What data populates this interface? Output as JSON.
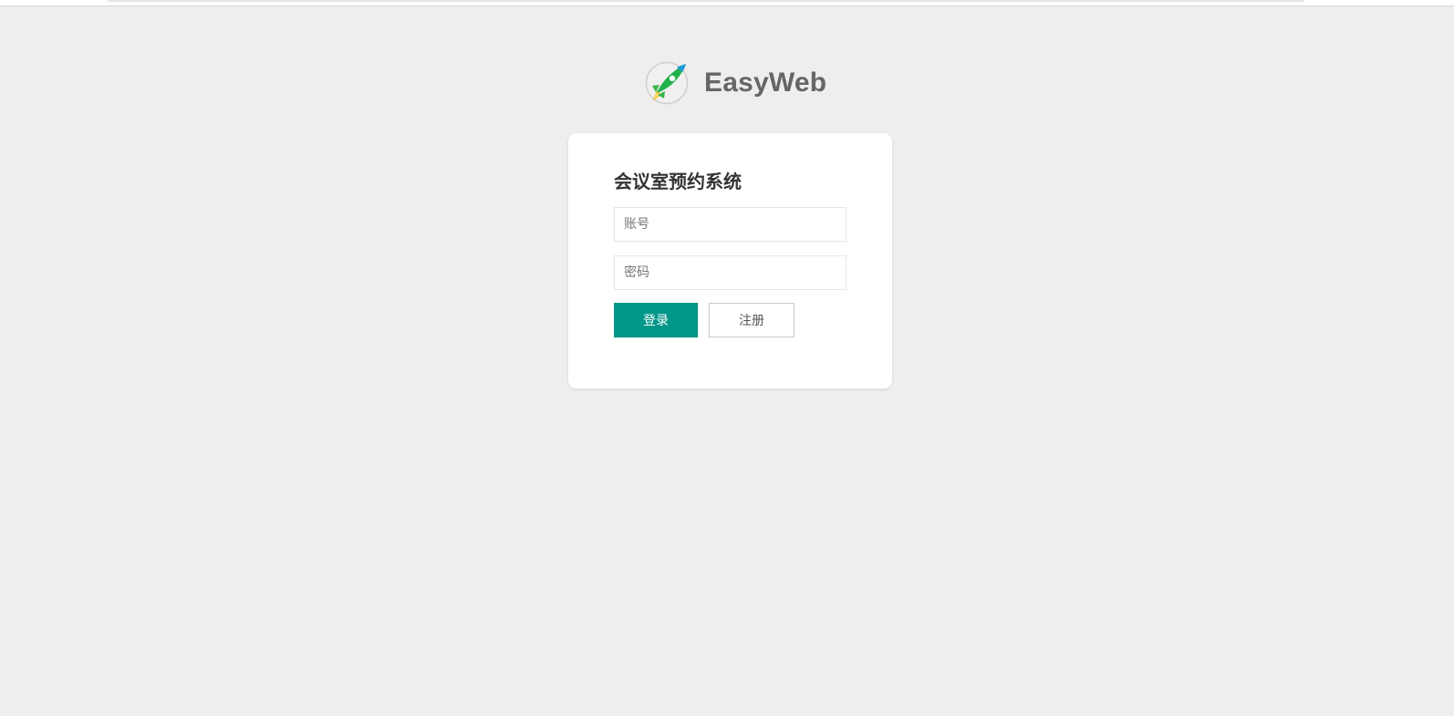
{
  "brand": {
    "name": "EasyWeb",
    "logo_icon": "rocket-icon"
  },
  "login": {
    "title": "会议室预约系统",
    "account_placeholder": "账号",
    "account_value": "",
    "password_placeholder": "密码",
    "password_value": "",
    "login_label": "登录",
    "register_label": "注册"
  },
  "colors": {
    "background": "#eeeeee",
    "primary": "#009688",
    "card": "#ffffff"
  }
}
